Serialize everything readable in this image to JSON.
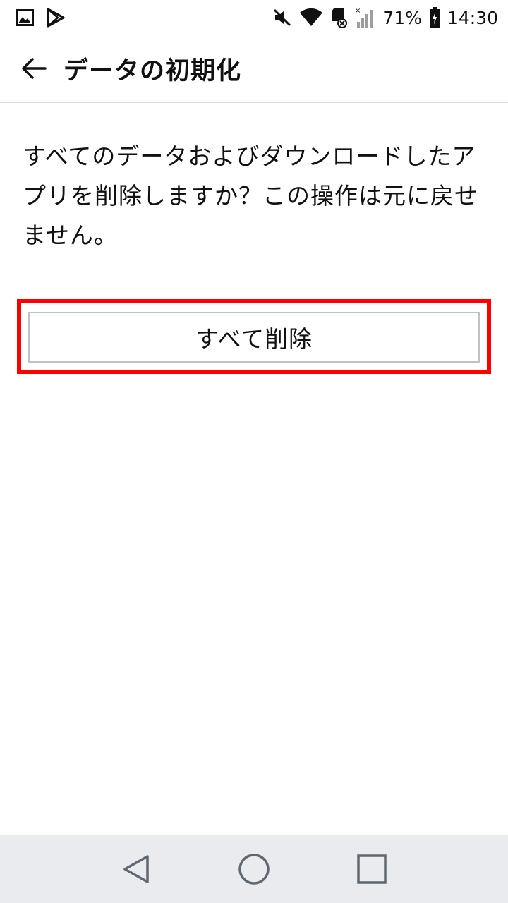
{
  "status_bar": {
    "battery_percent": "71%",
    "time": "14:30",
    "icons": [
      "image-icon",
      "play-store-icon",
      "mute-icon",
      "wifi-icon",
      "sd-card-icon",
      "signal-icon",
      "battery-icon"
    ]
  },
  "app_bar": {
    "title": "データの初期化",
    "back_icon": "arrow-left-icon"
  },
  "content": {
    "message": "すべてのデータおよびダウンロードしたアプリを削除しますか？この操作は元に戻せません。",
    "delete_all_label": "すべて削除"
  },
  "colors": {
    "highlight": "#ff0000",
    "nav_bar_bg": "#e9ebee",
    "divider": "#d9d9d9"
  },
  "nav_bar": {
    "icons": [
      "back-triangle-icon",
      "home-circle-icon",
      "recents-square-icon"
    ]
  }
}
